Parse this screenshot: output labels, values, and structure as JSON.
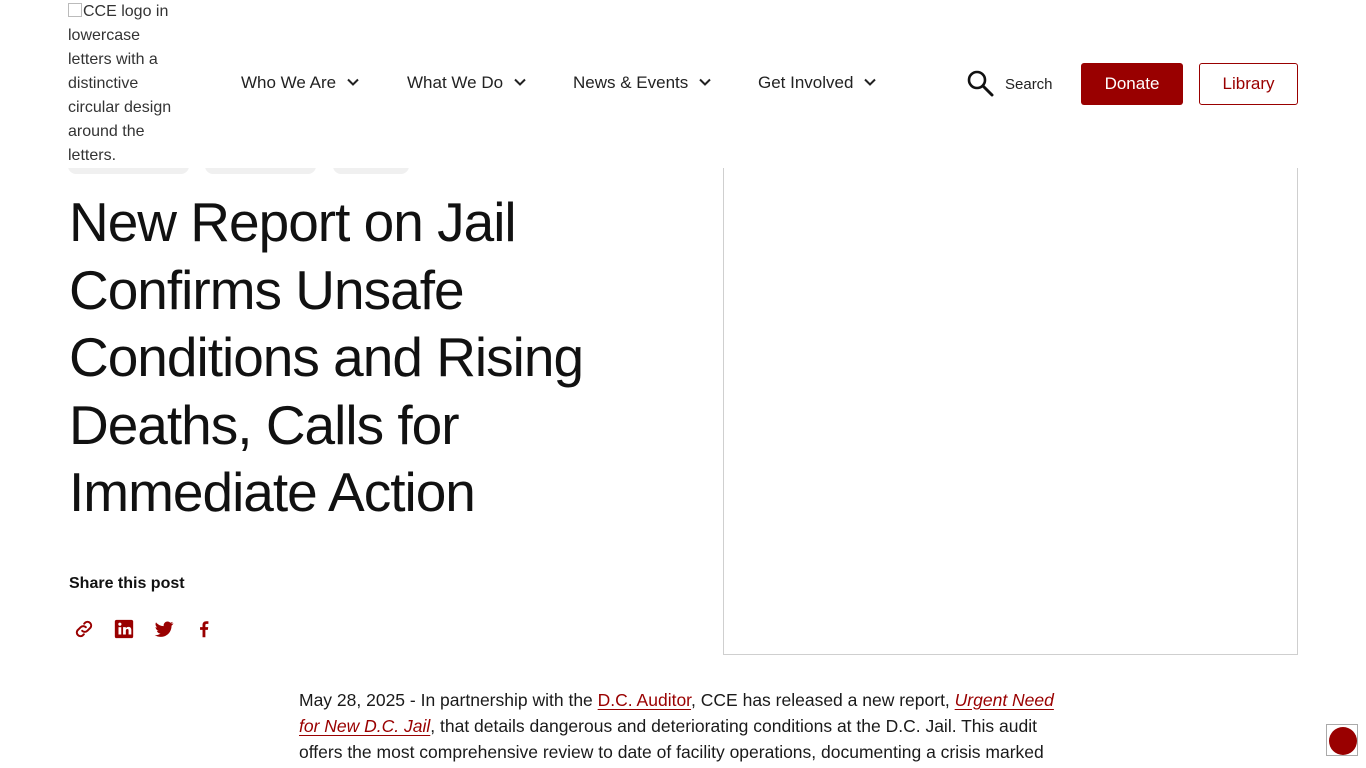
{
  "header": {
    "logo_alt": "CCE logo in lowercase letters with a distinctive circular design around the letters.",
    "nav": [
      {
        "label": "Who We Are"
      },
      {
        "label": "What We Do"
      },
      {
        "label": "News & Events"
      },
      {
        "label": "Get Involved"
      }
    ],
    "search_label": "Search",
    "donate_label": "Donate",
    "library_label": "Library"
  },
  "article": {
    "title": "New Report on Jail Confirms Unsafe Conditions and Rising Deaths, Calls for Immediate Action",
    "share_label": "Share this post",
    "share_icons": [
      "link-icon",
      "linkedin-icon",
      "twitter-icon",
      "facebook-icon"
    ],
    "date": "May 28, 2025",
    "p1_a": " - In partnership with the ",
    "auditor_link": "D.C. Auditor",
    "p1_b": ", CCE has released a new report, ",
    "report_link": "Urgent Need for New D.C. Jail",
    "p1_c": ", that details dangerous and deteriorating conditions at the D.C. Jail. This audit offers the most comprehensive review to date of facility operations, documenting a crisis marked"
  },
  "colors": {
    "brand": "#990000",
    "text": "#111111"
  }
}
